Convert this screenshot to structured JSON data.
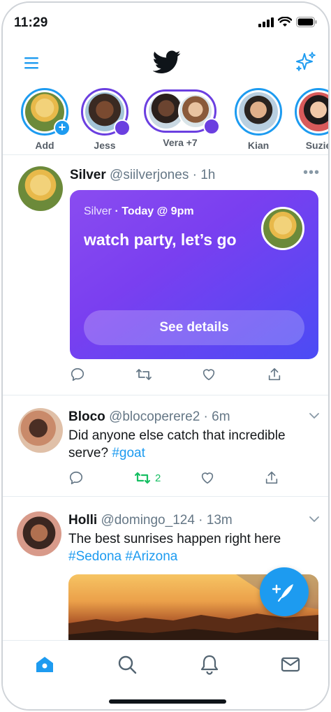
{
  "status_bar": {
    "time": "11:29"
  },
  "colors": {
    "accent": "#1d9bf0",
    "purple": "#6b3fe0",
    "retweet_green": "#17bf63"
  },
  "header": {
    "menu_icon": "hamburger-menu-icon",
    "logo_icon": "twitter-bird-icon",
    "sparkle_icon": "sparkle-icon"
  },
  "fleets": [
    {
      "label": "Add"
    },
    {
      "label": "Jess"
    },
    {
      "label": "Vera +7"
    },
    {
      "label": "Kian"
    },
    {
      "label": "Suzie"
    }
  ],
  "tweets": [
    {
      "name": "Silver",
      "handle": "@siilverjones",
      "time": "· 1h",
      "card": {
        "host": "Silver",
        "when": "· Today @ 9pm",
        "title": "watch party, let’s go",
        "button": "See details"
      }
    },
    {
      "name": "Bloco",
      "handle": "@blocoperere2 · 6m",
      "text": "Did anyone else catch that incredible serve? ",
      "hashtag": "#goat",
      "retweets": "2"
    },
    {
      "name": "Holli",
      "handle": "@domingo_124 · 13m",
      "text": "The best sunrises happen right here",
      "hashtags": "#Sedona #Arizona"
    }
  ],
  "tabbar": [
    "home-icon",
    "search-icon",
    "notifications-icon",
    "messages-icon"
  ]
}
